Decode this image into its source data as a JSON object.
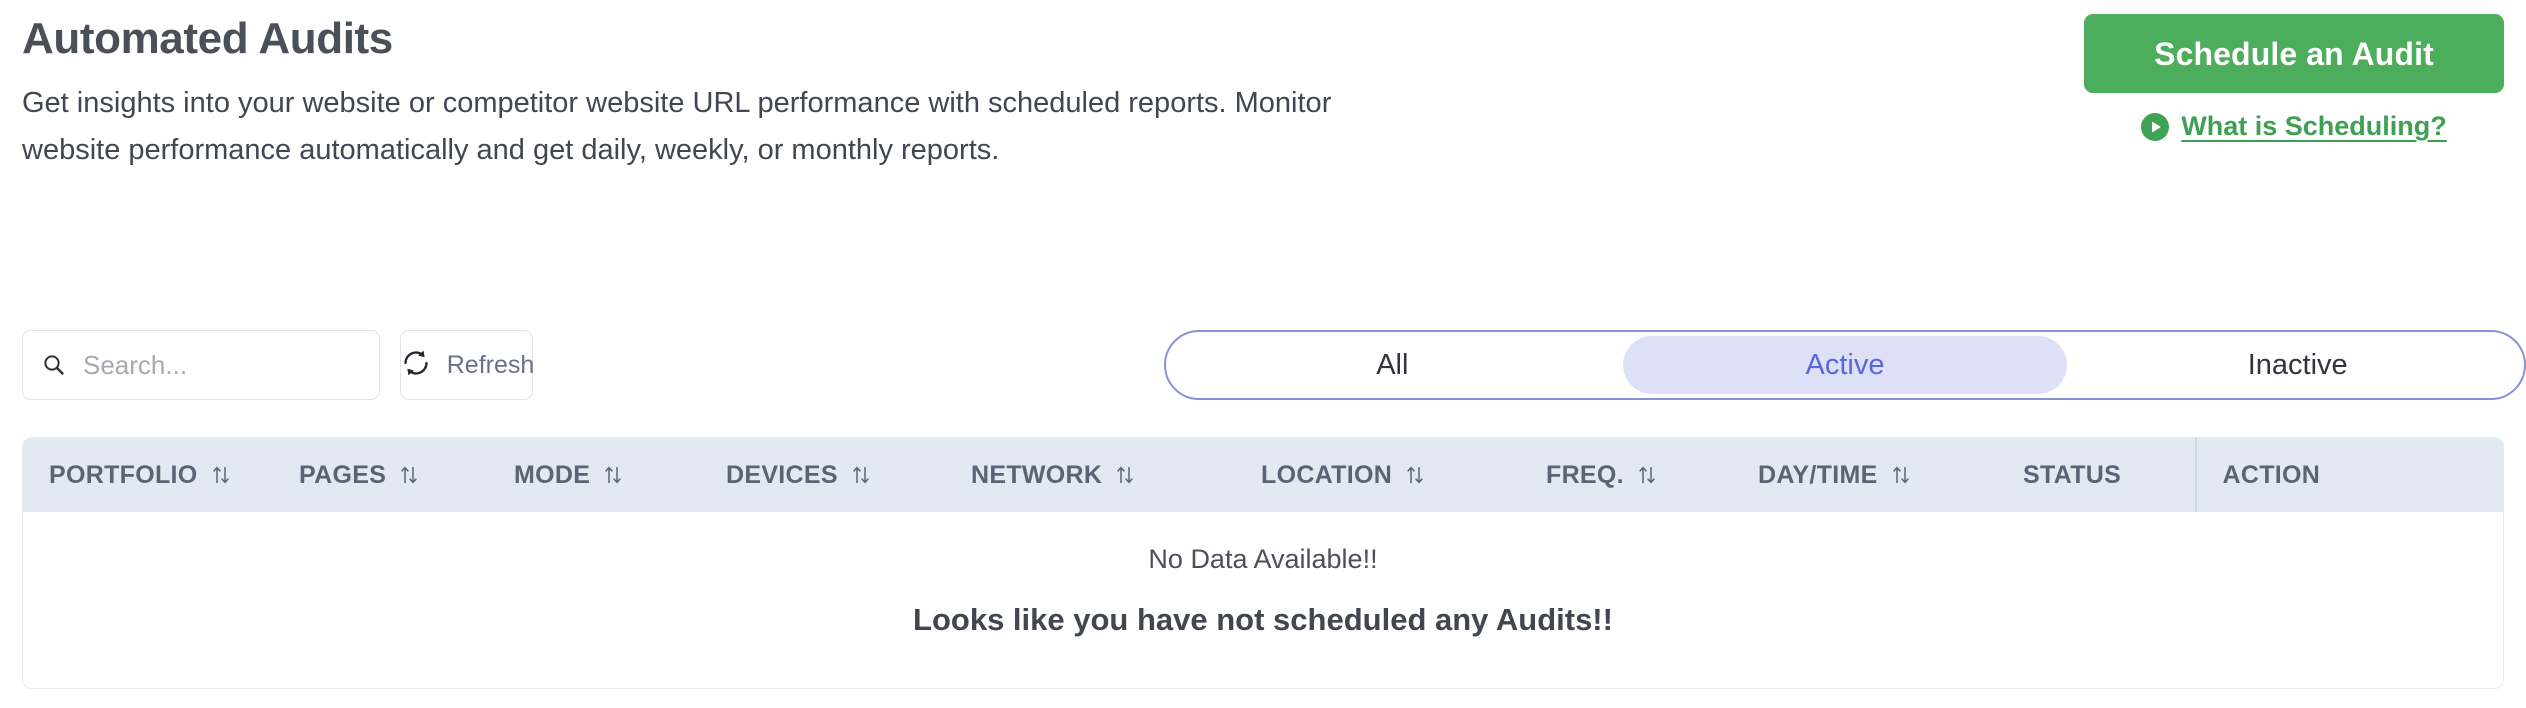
{
  "header": {
    "title": "Automated Audits",
    "description": "Get insights into your website or competitor website URL performance with scheduled reports. Monitor website performance automatically and get daily, weekly, or monthly reports.",
    "schedule_button": "Schedule an Audit",
    "what_is_link": "What is Scheduling?",
    "play_icon": "play-circle-icon"
  },
  "toolbar": {
    "search_placeholder": "Search...",
    "search_value": "",
    "search_icon": "search-icon",
    "refresh_label": "Refresh",
    "refresh_icon": "refresh-icon",
    "filters": [
      {
        "label": "All",
        "selected": false
      },
      {
        "label": "Active",
        "selected": true
      },
      {
        "label": "Inactive",
        "selected": false
      }
    ]
  },
  "table": {
    "columns": [
      {
        "label": "PORTFOLIO",
        "sortable": true
      },
      {
        "label": "PAGES",
        "sortable": true
      },
      {
        "label": "MODE",
        "sortable": true
      },
      {
        "label": "DEVICES",
        "sortable": true
      },
      {
        "label": "NETWORK",
        "sortable": true
      },
      {
        "label": "LOCATION",
        "sortable": true
      },
      {
        "label": "FREQ.",
        "sortable": true
      },
      {
        "label": "DAY/TIME",
        "sortable": true
      },
      {
        "label": "STATUS",
        "sortable": false
      },
      {
        "label": "ACTION",
        "sortable": false
      }
    ],
    "empty_primary": "No Data Available!!",
    "empty_secondary": "Looks like you have not scheduled any Audits!!",
    "rows": []
  },
  "colors": {
    "brand_green": "#4cae5c",
    "accent_purple": "#5767dd",
    "pill_bg": "#dde1f8",
    "table_header_bg": "#e3e9f3"
  }
}
